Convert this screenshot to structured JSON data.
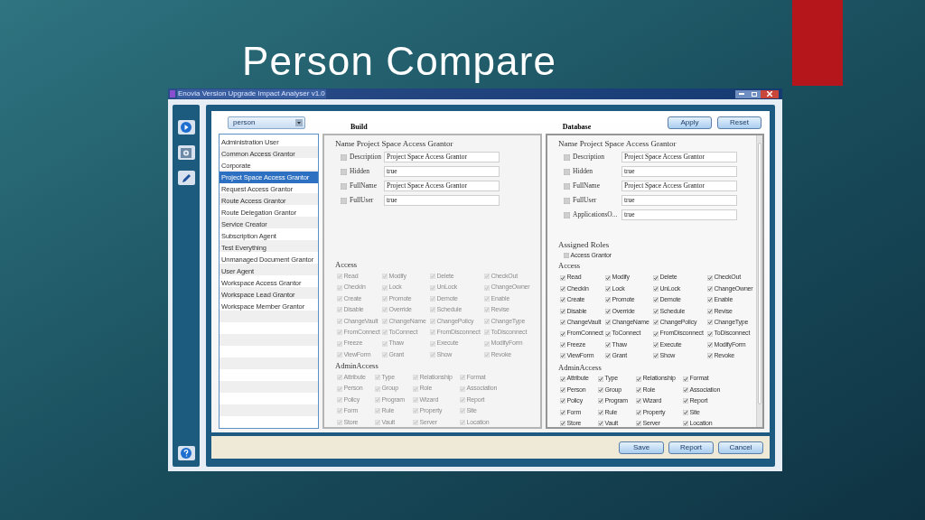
{
  "slide": {
    "title": "Person Compare"
  },
  "window": {
    "title": "Enovia Version Upgrade Impact Analyser v1.0"
  },
  "type_select": {
    "value": "person"
  },
  "list": [
    {
      "label": "Administration User",
      "selected": false
    },
    {
      "label": "Common Access Grantor",
      "selected": false
    },
    {
      "label": "Corporate",
      "selected": false
    },
    {
      "label": "Project Space Access Grantor",
      "selected": true
    },
    {
      "label": "Request Access Grantor",
      "selected": false
    },
    {
      "label": "Route Access Grantor",
      "selected": false
    },
    {
      "label": "Route Delegation Grantor",
      "selected": false
    },
    {
      "label": "Service Creator",
      "selected": false
    },
    {
      "label": "Subscription Agent",
      "selected": false
    },
    {
      "label": "Test Everything",
      "selected": false
    },
    {
      "label": "Unmanaged Document Grantor",
      "selected": false
    },
    {
      "label": "User Agent",
      "selected": false
    },
    {
      "label": "Workspace Access Grantor",
      "selected": false
    },
    {
      "label": "Workspace Lead Grantor",
      "selected": false
    },
    {
      "label": "Workspace Member Grantor",
      "selected": false
    }
  ],
  "top_buttons": [
    "Apply",
    "Reset"
  ],
  "panels": [
    {
      "heading": "Build",
      "disabled": true,
      "name": "Name Project Space Access Grantor",
      "fields": [
        {
          "label": "Description",
          "checked": false,
          "value": "Project Space Access Grantor"
        },
        {
          "label": "Hidden",
          "checked": false,
          "value": "true"
        },
        {
          "label": "FullName",
          "checked": false,
          "value": "Project Space Access Grantor"
        },
        {
          "label": "FullUser",
          "checked": false,
          "value": "true"
        }
      ],
      "access": {
        "title": "Access",
        "items": [
          {
            "label": "Read",
            "checked": true
          },
          {
            "label": "Modify",
            "checked": true
          },
          {
            "label": "Delete",
            "checked": true
          },
          {
            "label": "CheckOut",
            "checked": true
          },
          {
            "label": "CheckIn",
            "checked": true
          },
          {
            "label": "Lock",
            "checked": true
          },
          {
            "label": "UnLock",
            "checked": true
          },
          {
            "label": "ChangeOwner",
            "checked": true
          },
          {
            "label": "Create",
            "checked": true
          },
          {
            "label": "Promote",
            "checked": true
          },
          {
            "label": "Demote",
            "checked": true
          },
          {
            "label": "Enable",
            "checked": true
          },
          {
            "label": "Disable",
            "checked": true
          },
          {
            "label": "Override",
            "checked": true
          },
          {
            "label": "Schedule",
            "checked": true
          },
          {
            "label": "Revise",
            "checked": true
          },
          {
            "label": "ChangeVault",
            "checked": true
          },
          {
            "label": "ChangeName",
            "checked": true
          },
          {
            "label": "ChangePolicy",
            "checked": true
          },
          {
            "label": "ChangeType",
            "checked": true
          },
          {
            "label": "FromConnect",
            "checked": true
          },
          {
            "label": "ToConnect",
            "checked": true
          },
          {
            "label": "FromDisconnect",
            "checked": true
          },
          {
            "label": "ToDisconnect",
            "checked": true
          },
          {
            "label": "Freeze",
            "checked": true
          },
          {
            "label": "Thaw",
            "checked": true
          },
          {
            "label": "Execute",
            "checked": true
          },
          {
            "label": "ModifyForm",
            "checked": true
          },
          {
            "label": "ViewForm",
            "checked": true
          },
          {
            "label": "Grant",
            "checked": true
          },
          {
            "label": "Show",
            "checked": true
          },
          {
            "label": "Revoke",
            "checked": true
          }
        ]
      },
      "admin_access": {
        "title": "AdminAccess",
        "items": [
          {
            "label": "Attribute",
            "checked": true
          },
          {
            "label": "Type",
            "checked": true
          },
          {
            "label": "Relationship",
            "checked": true
          },
          {
            "label": "Format",
            "checked": true
          },
          {
            "label": "Person",
            "checked": true
          },
          {
            "label": "Group",
            "checked": true
          },
          {
            "label": "Role",
            "checked": true
          },
          {
            "label": "Association",
            "checked": true
          },
          {
            "label": "Policy",
            "checked": true
          },
          {
            "label": "Program",
            "checked": true
          },
          {
            "label": "Wizard",
            "checked": true
          },
          {
            "label": "Report",
            "checked": true
          },
          {
            "label": "Form",
            "checked": true
          },
          {
            "label": "Rule",
            "checked": true
          },
          {
            "label": "Property",
            "checked": true
          },
          {
            "label": "Site",
            "checked": true
          },
          {
            "label": "Store",
            "checked": true
          },
          {
            "label": "Vault",
            "checked": true
          },
          {
            "label": "Server",
            "checked": true
          },
          {
            "label": "Location",
            "checked": true
          }
        ]
      }
    },
    {
      "heading": "Database",
      "disabled": false,
      "name": "Name Project Space Access Grantor",
      "fields": [
        {
          "label": "Description",
          "checked": false,
          "value": "Project Space Access Grantor"
        },
        {
          "label": "Hidden",
          "checked": false,
          "value": "true"
        },
        {
          "label": "FullName",
          "checked": false,
          "value": "Project Space Access Grantor"
        },
        {
          "label": "FullUser",
          "checked": false,
          "value": "true"
        },
        {
          "label": "ApplicationsO...",
          "checked": false,
          "value": "true"
        }
      ],
      "assigned_roles": {
        "title": "Assigned Roles",
        "items": [
          {
            "label": "Access Grantor",
            "checked": false
          }
        ]
      },
      "access": {
        "title": "Access",
        "items": [
          {
            "label": "Read",
            "checked": true
          },
          {
            "label": "Modify",
            "checked": true
          },
          {
            "label": "Delete",
            "checked": true
          },
          {
            "label": "CheckOut",
            "checked": true
          },
          {
            "label": "CheckIn",
            "checked": true
          },
          {
            "label": "Lock",
            "checked": true
          },
          {
            "label": "UnLock",
            "checked": true
          },
          {
            "label": "ChangeOwner",
            "checked": true
          },
          {
            "label": "Create",
            "checked": true
          },
          {
            "label": "Promote",
            "checked": true
          },
          {
            "label": "Demote",
            "checked": true
          },
          {
            "label": "Enable",
            "checked": true
          },
          {
            "label": "Disable",
            "checked": true
          },
          {
            "label": "Override",
            "checked": true
          },
          {
            "label": "Schedule",
            "checked": true
          },
          {
            "label": "Revise",
            "checked": true
          },
          {
            "label": "ChangeVault",
            "checked": true
          },
          {
            "label": "ChangeName",
            "checked": true
          },
          {
            "label": "ChangePolicy",
            "checked": true
          },
          {
            "label": "ChangeType",
            "checked": true
          },
          {
            "label": "FromConnect",
            "checked": true
          },
          {
            "label": "ToConnect",
            "checked": true
          },
          {
            "label": "FromDisconnect",
            "checked": true
          },
          {
            "label": "ToDisconnect",
            "checked": true
          },
          {
            "label": "Freeze",
            "checked": true
          },
          {
            "label": "Thaw",
            "checked": true
          },
          {
            "label": "Execute",
            "checked": true
          },
          {
            "label": "ModifyForm",
            "checked": true
          },
          {
            "label": "ViewForm",
            "checked": true
          },
          {
            "label": "Grant",
            "checked": true
          },
          {
            "label": "Show",
            "checked": true
          },
          {
            "label": "Revoke",
            "checked": true
          }
        ]
      },
      "admin_access": {
        "title": "AdminAccess",
        "items": [
          {
            "label": "Attribute",
            "checked": true
          },
          {
            "label": "Type",
            "checked": true
          },
          {
            "label": "Relationship",
            "checked": true
          },
          {
            "label": "Format",
            "checked": true
          },
          {
            "label": "Person",
            "checked": true
          },
          {
            "label": "Group",
            "checked": true
          },
          {
            "label": "Role",
            "checked": true
          },
          {
            "label": "Association",
            "checked": true
          },
          {
            "label": "Policy",
            "checked": true
          },
          {
            "label": "Program",
            "checked": true
          },
          {
            "label": "Wizard",
            "checked": true
          },
          {
            "label": "Report",
            "checked": true
          },
          {
            "label": "Form",
            "checked": true
          },
          {
            "label": "Rule",
            "checked": true
          },
          {
            "label": "Property",
            "checked": true
          },
          {
            "label": "Site",
            "checked": true
          },
          {
            "label": "Store",
            "checked": true
          },
          {
            "label": "Vault",
            "checked": true
          },
          {
            "label": "Server",
            "checked": true
          },
          {
            "label": "Location",
            "checked": true
          }
        ]
      }
    }
  ],
  "bottom_buttons": [
    "Save",
    "Report",
    "Cancel"
  ]
}
